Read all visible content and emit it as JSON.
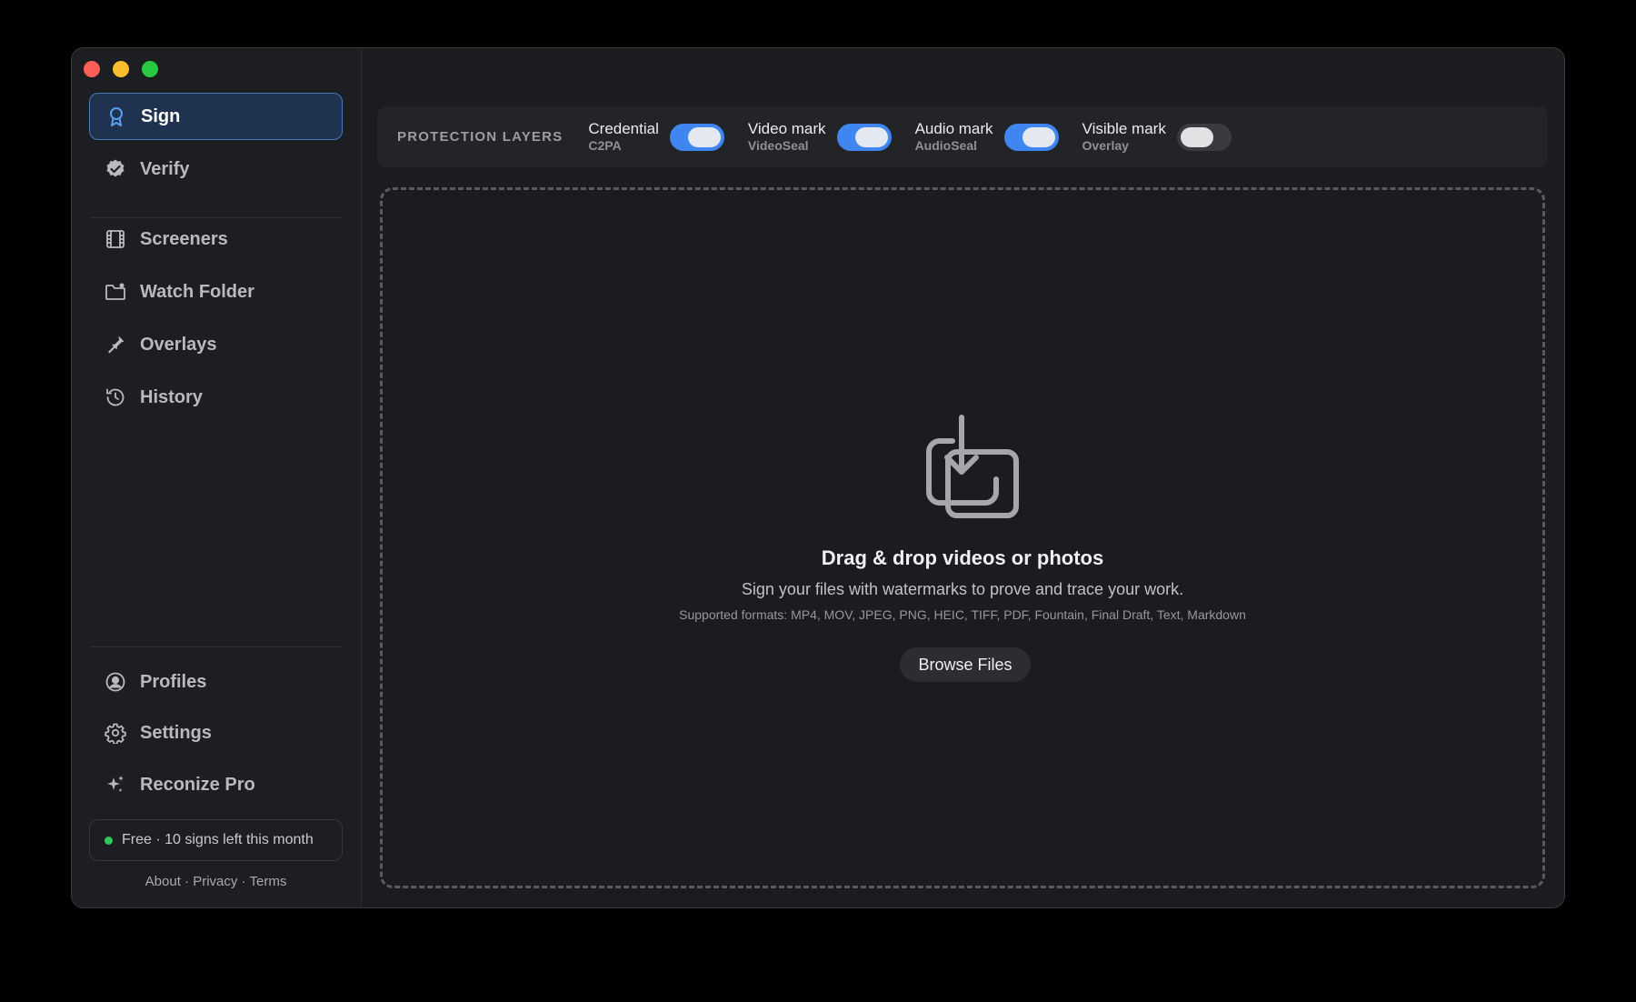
{
  "sidebar": {
    "nav": [
      {
        "label": "Sign",
        "icon": "ribbon-badge-icon",
        "active": true
      },
      {
        "label": "Verify",
        "icon": "verified-check-icon"
      },
      {
        "label": "Screeners",
        "icon": "film-icon"
      },
      {
        "label": "Watch Folder",
        "icon": "folder-gear-icon"
      },
      {
        "label": "Overlays",
        "icon": "stamp-icon"
      },
      {
        "label": "History",
        "icon": "history-clock-icon"
      }
    ],
    "bottom_nav": [
      {
        "label": "Profiles",
        "icon": "person-circle-icon"
      },
      {
        "label": "Settings",
        "icon": "gear-icon"
      },
      {
        "label": "Reconize Pro",
        "icon": "sparkle-icon"
      }
    ],
    "plan_status": "Free · 10 signs left this month",
    "plan_status_color": "#30c85a",
    "footer": {
      "about": "About",
      "privacy": "Privacy",
      "terms": "Terms",
      "separator": "·"
    }
  },
  "protection": {
    "title": "PROTECTION LAYERS",
    "layers": [
      {
        "name": "Credential",
        "sub": "C2PA",
        "enabled": true
      },
      {
        "name": "Video mark",
        "sub": "VideoSeal",
        "enabled": true
      },
      {
        "name": "Audio mark",
        "sub": "AudioSeal",
        "enabled": true
      },
      {
        "name": "Visible mark",
        "sub": "Overlay",
        "enabled": false
      }
    ],
    "accent": "#3f86f0"
  },
  "dropzone": {
    "icon": "download-tray-icon",
    "title": "Drag & drop videos or photos",
    "subtitle": "Sign your files with watermarks to prove and trace your work.",
    "formats": "Supported formats: MP4, MOV, JPEG, PNG, HEIC, TIFF, PDF, Fountain, Final Draft, Text, Markdown",
    "button": "Browse Files"
  }
}
